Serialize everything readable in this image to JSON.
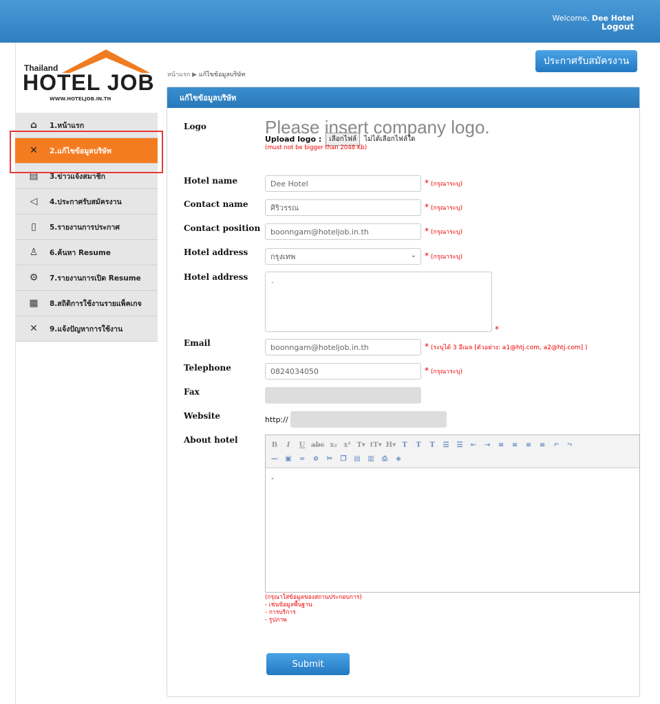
{
  "header": {
    "welcome_prefix": "Welcome, ",
    "user": "Dee Hotel",
    "logout": "Logout"
  },
  "logo": {
    "thailand": "Thailand",
    "name": "HOTEL JOB",
    "url": "WWW.HOTELJOB.IN.TH"
  },
  "sidebar": {
    "items": [
      {
        "label": "1.หน้าแรก",
        "icon": "home-icon"
      },
      {
        "label": "2.แก้ไขข้อมูลบริษัท",
        "icon": "tools-icon"
      },
      {
        "label": "3.ข่าวแจ้งสมาชิก",
        "icon": "news-icon"
      },
      {
        "label": "4.ประกาศรับสมัครงาน",
        "icon": "megaphone-icon"
      },
      {
        "label": "5.รายงานการประกาศ",
        "icon": "document-icon"
      },
      {
        "label": "6.ค้นหา Resume",
        "icon": "search-person-icon"
      },
      {
        "label": "7.รายงานการเปิด Resume",
        "icon": "report-icon"
      },
      {
        "label": "8.สถิติการใช้งานรายแพ็คเกจ",
        "icon": "stats-icon"
      },
      {
        "label": "9.แจ้งปัญหาการใช้งาน",
        "icon": "tools-icon"
      }
    ]
  },
  "breadcrumb": {
    "home": "หน้าแรก",
    "sep": "▶",
    "current": "แก้ไขข้อมูลบริษัท"
  },
  "top_button": "ประกาศรับสมัครงาน",
  "panel": {
    "title": "แก้ไขข้อมูลบริษัท"
  },
  "form": {
    "logo_label": "Logo",
    "logo_placeholder": "Please insert company logo.",
    "upload_label": "Upload logo :",
    "choose_file": "เลือกไฟล์",
    "no_file": "ไม่ได้เลือกไฟล์ใด",
    "logo_limit": "(must not be bigger than 2048 Kb)",
    "hotel_name_label": "Hotel name",
    "hotel_name_value": "Dee Hotel",
    "contact_name_label": "Contact name",
    "contact_name_value": "ศิริวรรณ",
    "contact_position_label": "Contact position",
    "contact_position_value": "boonngam@hoteljob.in.th",
    "hotel_address_label": "Hotel address",
    "hotel_address_select": "กรุงเทพ",
    "hotel_address2_label": "Hotel address",
    "hotel_address2_value": "-",
    "email_label": "Email",
    "email_value": "boonngam@hoteljob.in.th",
    "email_note": "(ระบุได้ 3 อีเมล [ตัวอย่าง: a1@htj.com, a2@htj.com] )",
    "telephone_label": "Telephone",
    "telephone_value": "0824034050",
    "fax_label": "Fax",
    "fax_value": "",
    "website_label": "Website",
    "website_prefix": "http://",
    "website_value": "",
    "about_label": "About hotel",
    "about_value": "-",
    "required_note": "(กรุณาระบุ)",
    "star": "*",
    "hint1": "(กรุณาใส่ข้อมูลของสถานประกอบการ)",
    "hint2": "- เช่นข้อมูลพื้นฐาน",
    "hint3": "- การบริการ",
    "hint4": "- รูปภาพ",
    "submit": "Submit"
  },
  "colors": {
    "header": "#3a8fcf",
    "active": "#f47c20",
    "required": "#e00000"
  }
}
